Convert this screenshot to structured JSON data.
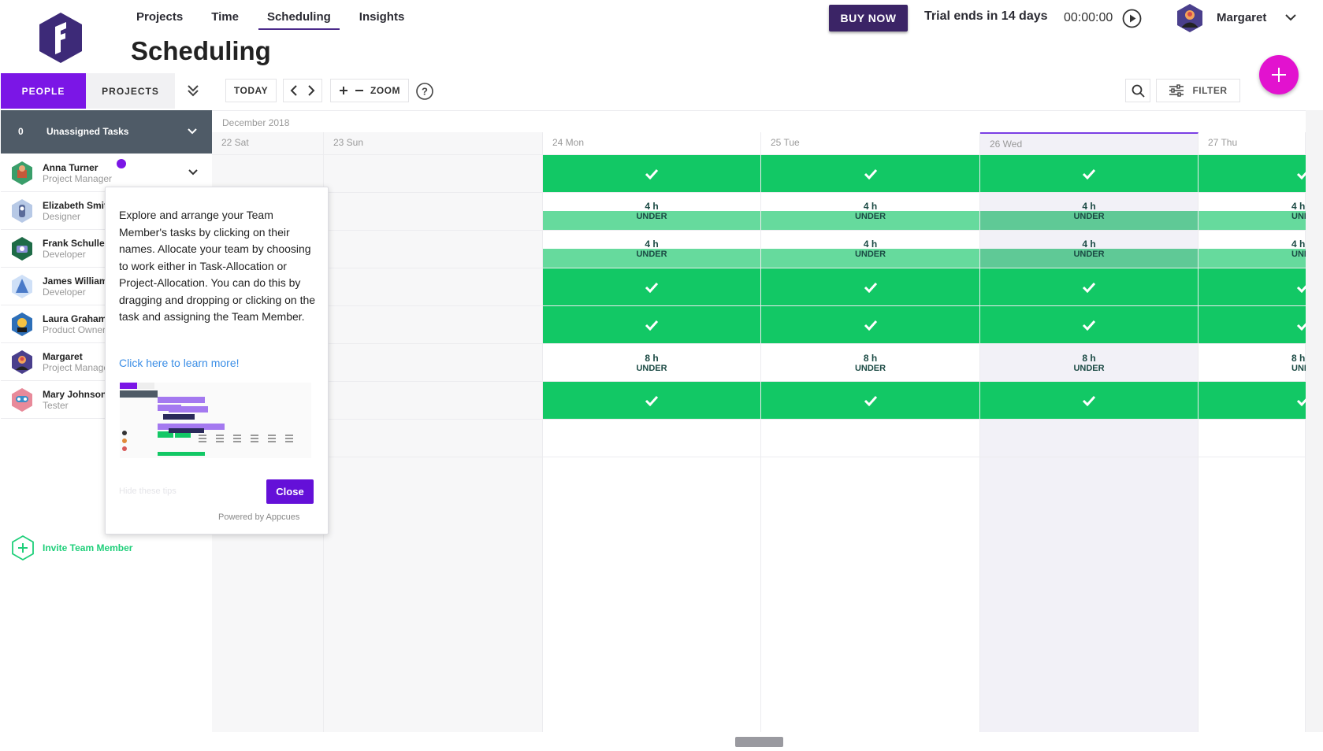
{
  "nav": {
    "items": [
      {
        "label": "Projects",
        "active": false
      },
      {
        "label": "Time",
        "active": false
      },
      {
        "label": "Scheduling",
        "active": true
      },
      {
        "label": "Insights",
        "active": false
      }
    ]
  },
  "page": {
    "title": "Scheduling"
  },
  "header": {
    "buy_now": "BUY NOW",
    "trial": "Trial ends in 14 days",
    "timer": "00:00:00",
    "user_name": "Margaret"
  },
  "toolbar": {
    "people_tab": "PEOPLE",
    "projects_tab": "PROJECTS",
    "today": "TODAY",
    "zoom": "ZOOM",
    "filter": "FILTER"
  },
  "sidebar": {
    "unassigned_count": "0",
    "unassigned_label": "Unassigned Tasks",
    "people": [
      {
        "name": "Anna Turner",
        "role": "Project Manager"
      },
      {
        "name": "Elizabeth Smith",
        "role": "Designer"
      },
      {
        "name": "Frank Schuller",
        "role": "Developer"
      },
      {
        "name": "James Williams",
        "role": "Developer"
      },
      {
        "name": "Laura Graham",
        "role": "Product Owner"
      },
      {
        "name": "Margaret",
        "role": "Project Manager"
      },
      {
        "name": "Mary Johnson",
        "role": "Tester"
      }
    ],
    "invite": "Invite Team Member"
  },
  "calendar": {
    "month": "December 2018",
    "days": [
      "22 Sat",
      "23 Sun",
      "24 Mon",
      "25 Tue",
      "26 Wed",
      "27 Thu"
    ],
    "under_hours_4": "4 h",
    "under_hours_8": "8 h",
    "under_label": "UNDER"
  },
  "tooltip": {
    "body": "Explore and arrange your Team Member's tasks by clicking on their names. Allocate your team by choosing to work either in Task-Allocation or Project-Allocation. You can do this by dragging and dropping or clicking on the task and assigning the Team Member.",
    "link": "Click here to learn more!",
    "hide": "Hide these tips",
    "close": "Close",
    "powered": "Powered by Appcues"
  },
  "colors": {
    "brand_purple": "#7b16e6",
    "buy_now_bg": "#3b2466",
    "fab_pink": "#e212cf",
    "allocated_green": "#12c865",
    "under_green": "#66da9d",
    "invite_green": "#1fcf7a"
  }
}
